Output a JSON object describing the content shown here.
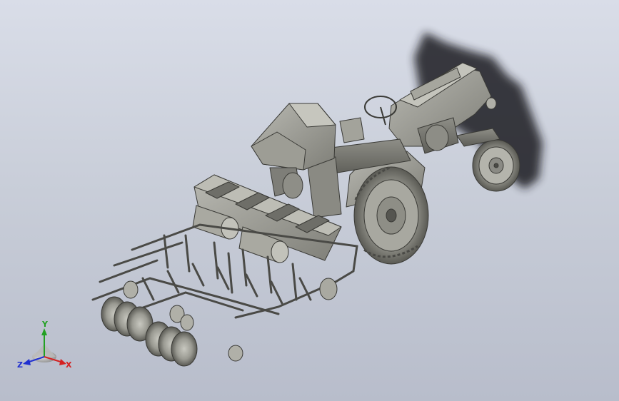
{
  "viewport": {
    "background_top": "#d9dde8",
    "background_bottom": "#b8bdcb",
    "model_color": "#9a9a92",
    "shadow_color": "#1e1e22"
  },
  "triad": {
    "x_label": "X",
    "y_label": "Y",
    "z_label": "Z",
    "x_color": "#d42020",
    "y_color": "#22a022",
    "z_color": "#2030d0"
  }
}
